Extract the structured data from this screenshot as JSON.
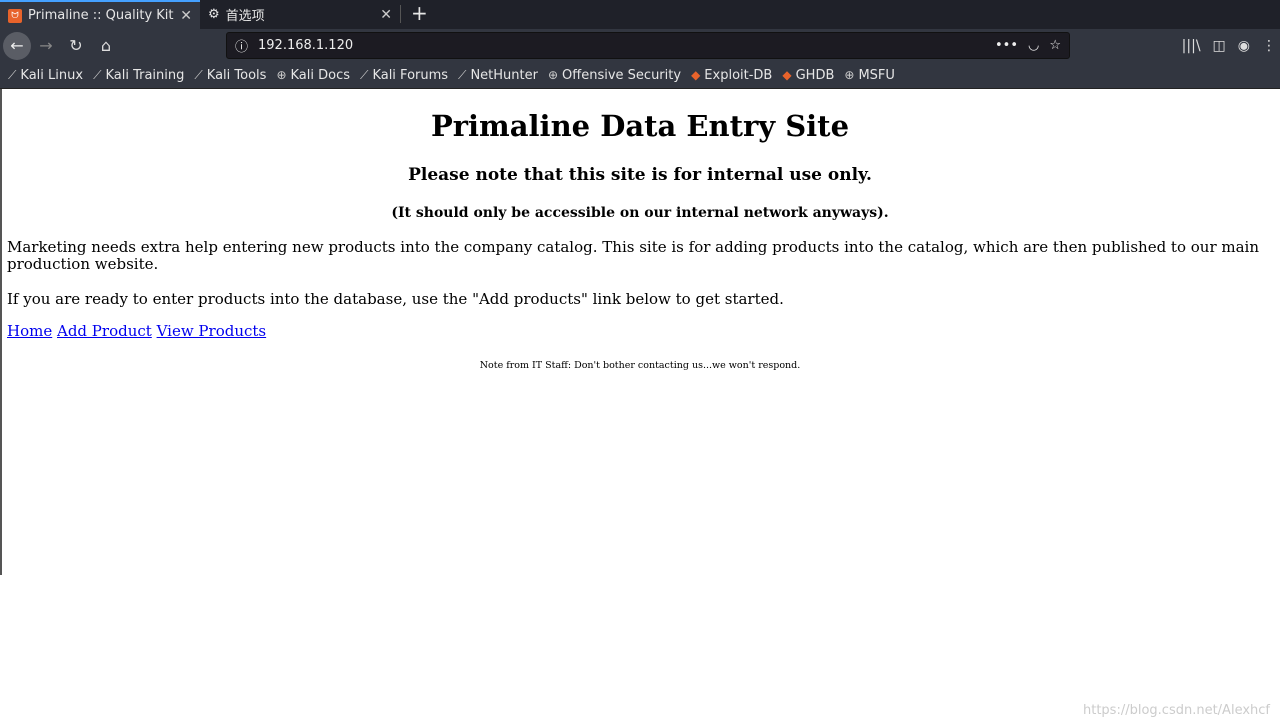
{
  "browser": {
    "tabs": [
      {
        "title": "Primaline :: Quality Kitchen",
        "active": true,
        "icon": "xampp-icon"
      },
      {
        "title": "首选项",
        "active": false,
        "icon": "gear-icon"
      }
    ],
    "url": "192.168.1.120",
    "bookmarks": [
      {
        "label": "Kali Linux",
        "icon": "kali-dragon-icon"
      },
      {
        "label": "Kali Training",
        "icon": "kali-dragon-icon"
      },
      {
        "label": "Kali Tools",
        "icon": "kali-dragon-icon"
      },
      {
        "label": "Kali Docs",
        "icon": "globe-icon"
      },
      {
        "label": "Kali Forums",
        "icon": "kali-dragon-icon"
      },
      {
        "label": "NetHunter",
        "icon": "kali-dragon-icon"
      },
      {
        "label": "Offensive Security",
        "icon": "globe-icon"
      },
      {
        "label": "Exploit-DB",
        "icon": "exploitdb-icon"
      },
      {
        "label": "GHDB",
        "icon": "exploitdb-icon"
      },
      {
        "label": "MSFU",
        "icon": "globe-icon"
      }
    ]
  },
  "page": {
    "title": "Primaline Data Entry Site",
    "subtitle": "Please note that this site is for internal use only.",
    "subnote": "(It should only be accessible on our internal network anyways).",
    "para1": "Marketing needs extra help entering new products into the company catalog. This site is for adding products into the catalog, which are then published to our main production website.",
    "para2": "If you are ready to enter products into the database, use the \"Add products\" link below to get started.",
    "links": [
      "Home",
      "Add Product",
      "View Products"
    ],
    "note": "Note from IT Staff: Don't bother contacting us...we won't respond."
  },
  "watermark": "https://blog.csdn.net/Alexhcf"
}
